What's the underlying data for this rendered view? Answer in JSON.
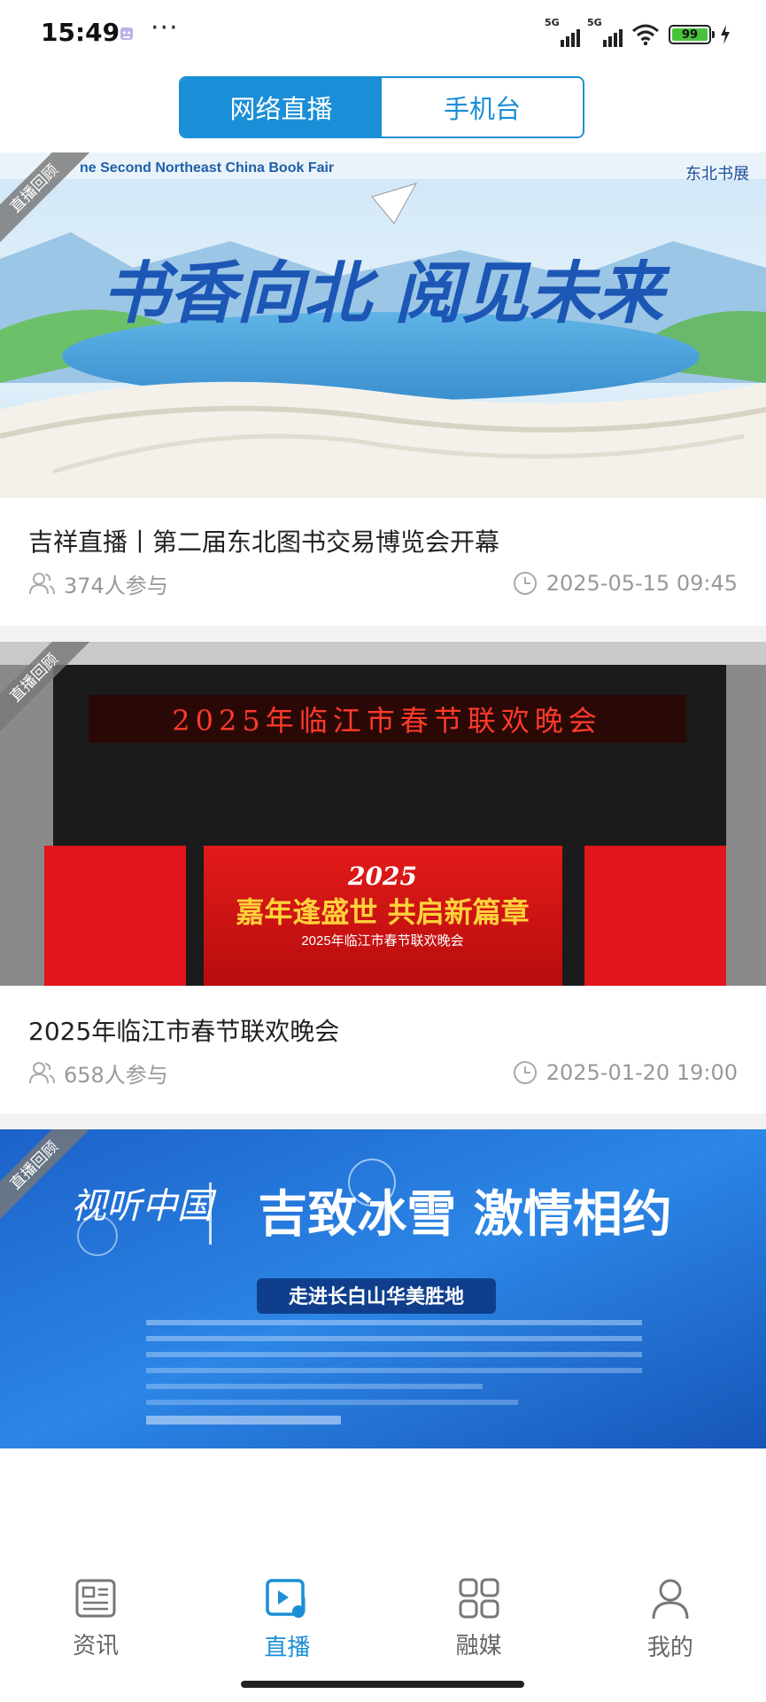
{
  "status_bar": {
    "time": "15:49",
    "more": "···",
    "network_1": "5G",
    "network_2": "5G",
    "battery": "99"
  },
  "tabs": [
    {
      "label": "网络直播",
      "active": true
    },
    {
      "label": "手机台",
      "active": false
    }
  ],
  "cards": [
    {
      "badge": "直播回顾",
      "banner_header": "ne Second Northeast China Book Fair",
      "banner_slogan": "书香向北 阅见未来",
      "banner_logo": "东北书展",
      "title": "吉祥直播丨第二届东北图书交易博览会开幕",
      "participants": "374人参与",
      "time": "2025-05-15 09:45"
    },
    {
      "badge": "直播回顾",
      "banner_marquee": "2025年临江市春节联欢晚会",
      "banner_year": "2025",
      "banner_slogan": "嘉年逢盛世 共启新篇章",
      "banner_subtitle": "2025年临江市春节联欢晚会",
      "title": "2025年临江市春节联欢晚会",
      "participants": "658人参与",
      "time": "2025-01-20 19:00"
    },
    {
      "badge": "直播回顾",
      "banner_logo": "视听中国",
      "banner_slogan": "吉致冰雪 激情相约",
      "banner_subtitle": "走进长白山华美胜地"
    }
  ],
  "bottom_nav": [
    {
      "label": "资讯",
      "icon": "news-icon",
      "active": false
    },
    {
      "label": "直播",
      "icon": "live-icon",
      "active": true
    },
    {
      "label": "融媒",
      "icon": "grid-icon",
      "active": false
    },
    {
      "label": "我的",
      "icon": "profile-icon",
      "active": false
    }
  ],
  "colors": {
    "accent": "#1a8ed6",
    "inactive_nav": "#666666",
    "meta_text": "#999999",
    "battery_fill": "#48c23a"
  }
}
